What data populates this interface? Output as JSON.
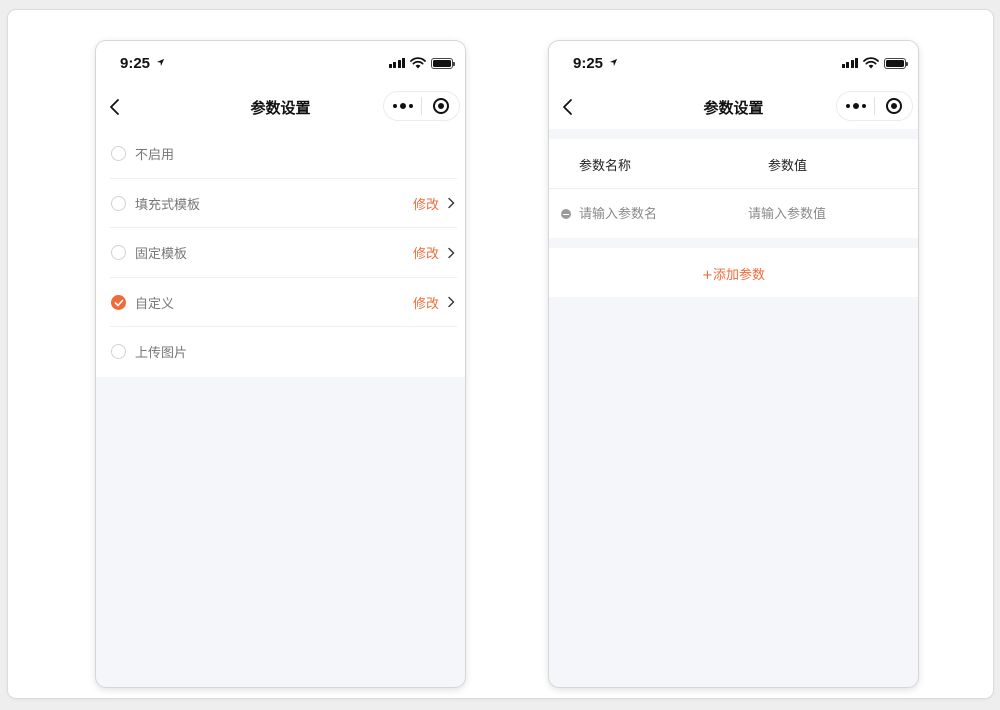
{
  "colors": {
    "accent": "#ef6c3a",
    "page_bg": "#f5f6fa"
  },
  "status_bar": {
    "time": "9:25"
  },
  "left_screen": {
    "title": "参数设置",
    "options": [
      {
        "label": "不启用",
        "checked": false,
        "edit": ""
      },
      {
        "label": "填充式模板",
        "checked": false,
        "edit": "修改"
      },
      {
        "label": "固定模板",
        "checked": false,
        "edit": "修改"
      },
      {
        "label": "自定义",
        "checked": true,
        "edit": "修改"
      },
      {
        "label": "上传图片",
        "checked": false,
        "edit": ""
      }
    ]
  },
  "right_screen": {
    "title": "参数设置",
    "headers": {
      "name": "参数名称",
      "value": "参数值"
    },
    "row": {
      "name_placeholder": "请输入参数名",
      "value_placeholder": "请输入参数值"
    },
    "add_button": "+添加参数"
  },
  "icons": [
    "location-arrow-icon",
    "signal-icon",
    "wifi-icon",
    "battery-icon",
    "back-chevron-icon",
    "more-icon",
    "close-target-icon",
    "chevron-right-icon",
    "checkmark-icon",
    "remove-icon"
  ]
}
